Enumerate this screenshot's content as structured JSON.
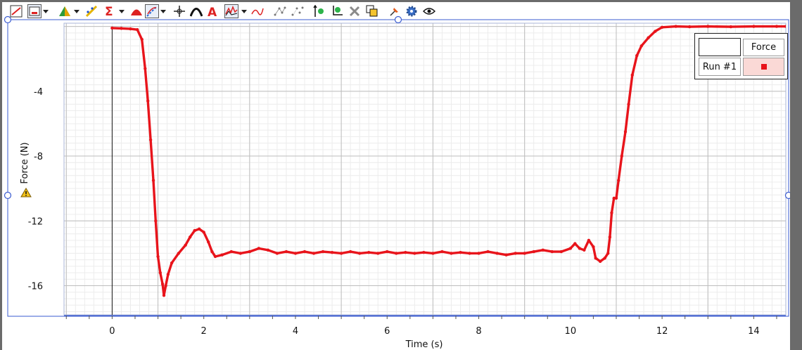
{
  "toolbar": {
    "icons": [
      "graph-options-icon",
      "data-selector-icon",
      "analysis-icon",
      "curve-fit-icon",
      "statistics-icon",
      "tangent-icon",
      "examine-icon",
      "model-icon",
      "annotation-icon",
      "graph-style-icon",
      "derivative-icon",
      "connect-points-icon",
      "disconnect-points-icon",
      "autoscale-icon",
      "zoom-fit-icon",
      "delete-icon",
      "copy-icon",
      "pin-icon",
      "settings-icon",
      "visibility-icon"
    ]
  },
  "colors": {
    "series": "#e8141b",
    "grid_major": "#bdbdbd",
    "grid_minor": "#ececec",
    "axis_frame": "#3a5bd0",
    "legend_swatch_bg": "#fad9d6",
    "background_outer": "#6b6b6b"
  },
  "legend": {
    "header": "Force",
    "run_label": "Run #1"
  },
  "warning_icon": "warning-triangle-icon",
  "chart_data": {
    "type": "line",
    "xlabel": "Time (s)",
    "ylabel": "Force (N)",
    "xlim": [
      -1.05,
      14.7
    ],
    "ylim": [
      -17.8,
      0.2
    ],
    "x_ticks": [
      0,
      2,
      4,
      6,
      8,
      10,
      12,
      14
    ],
    "y_ticks": [
      -4,
      -8,
      -12,
      -16
    ],
    "grid": true,
    "legend_position": "top-right",
    "series": [
      {
        "name": "Force",
        "points": [
          [
            0.0,
            -0.1
          ],
          [
            0.2,
            -0.12
          ],
          [
            0.4,
            -0.15
          ],
          [
            0.55,
            -0.2
          ],
          [
            0.65,
            -0.8
          ],
          [
            0.72,
            -2.6
          ],
          [
            0.78,
            -4.6
          ],
          [
            0.84,
            -7.0
          ],
          [
            0.9,
            -9.5
          ],
          [
            0.95,
            -12.0
          ],
          [
            1.0,
            -14.2
          ],
          [
            1.05,
            -15.2
          ],
          [
            1.1,
            -15.9
          ],
          [
            1.13,
            -16.6
          ],
          [
            1.17,
            -16.0
          ],
          [
            1.22,
            -15.3
          ],
          [
            1.3,
            -14.6
          ],
          [
            1.45,
            -14.0
          ],
          [
            1.6,
            -13.5
          ],
          [
            1.7,
            -13.0
          ],
          [
            1.8,
            -12.6
          ],
          [
            1.9,
            -12.5
          ],
          [
            2.0,
            -12.7
          ],
          [
            2.1,
            -13.3
          ],
          [
            2.18,
            -13.9
          ],
          [
            2.25,
            -14.2
          ],
          [
            2.4,
            -14.1
          ],
          [
            2.6,
            -13.9
          ],
          [
            2.8,
            -14.0
          ],
          [
            3.0,
            -13.9
          ],
          [
            3.2,
            -13.7
          ],
          [
            3.4,
            -13.8
          ],
          [
            3.6,
            -14.0
          ],
          [
            3.8,
            -13.9
          ],
          [
            4.0,
            -14.0
          ],
          [
            4.2,
            -13.9
          ],
          [
            4.4,
            -14.0
          ],
          [
            4.6,
            -13.9
          ],
          [
            4.8,
            -13.95
          ],
          [
            5.0,
            -14.0
          ],
          [
            5.2,
            -13.9
          ],
          [
            5.4,
            -14.0
          ],
          [
            5.6,
            -13.95
          ],
          [
            5.8,
            -14.0
          ],
          [
            6.0,
            -13.9
          ],
          [
            6.2,
            -14.0
          ],
          [
            6.4,
            -13.95
          ],
          [
            6.6,
            -14.0
          ],
          [
            6.8,
            -13.95
          ],
          [
            7.0,
            -14.0
          ],
          [
            7.2,
            -13.9
          ],
          [
            7.4,
            -14.0
          ],
          [
            7.6,
            -13.95
          ],
          [
            7.8,
            -14.0
          ],
          [
            8.0,
            -14.0
          ],
          [
            8.2,
            -13.9
          ],
          [
            8.4,
            -14.0
          ],
          [
            8.6,
            -14.1
          ],
          [
            8.8,
            -14.0
          ],
          [
            9.0,
            -14.0
          ],
          [
            9.2,
            -13.9
          ],
          [
            9.4,
            -13.8
          ],
          [
            9.6,
            -13.9
          ],
          [
            9.8,
            -13.9
          ],
          [
            10.0,
            -13.7
          ],
          [
            10.1,
            -13.4
          ],
          [
            10.2,
            -13.7
          ],
          [
            10.3,
            -13.8
          ],
          [
            10.4,
            -13.2
          ],
          [
            10.5,
            -13.6
          ],
          [
            10.55,
            -14.3
          ],
          [
            10.65,
            -14.5
          ],
          [
            10.75,
            -14.3
          ],
          [
            10.82,
            -14.0
          ],
          [
            10.86,
            -13.0
          ],
          [
            10.9,
            -11.5
          ],
          [
            10.95,
            -10.6
          ],
          [
            11.0,
            -10.6
          ],
          [
            11.05,
            -9.5
          ],
          [
            11.12,
            -8.0
          ],
          [
            11.2,
            -6.5
          ],
          [
            11.27,
            -4.8
          ],
          [
            11.35,
            -3.0
          ],
          [
            11.45,
            -1.8
          ],
          [
            11.55,
            -1.2
          ],
          [
            11.7,
            -0.7
          ],
          [
            11.85,
            -0.3
          ],
          [
            12.0,
            -0.05
          ],
          [
            12.3,
            0.0
          ],
          [
            12.6,
            -0.02
          ],
          [
            13.0,
            0.0
          ],
          [
            13.5,
            -0.02
          ],
          [
            14.0,
            0.0
          ],
          [
            14.5,
            0.0
          ],
          [
            14.7,
            0.0
          ]
        ]
      }
    ]
  }
}
